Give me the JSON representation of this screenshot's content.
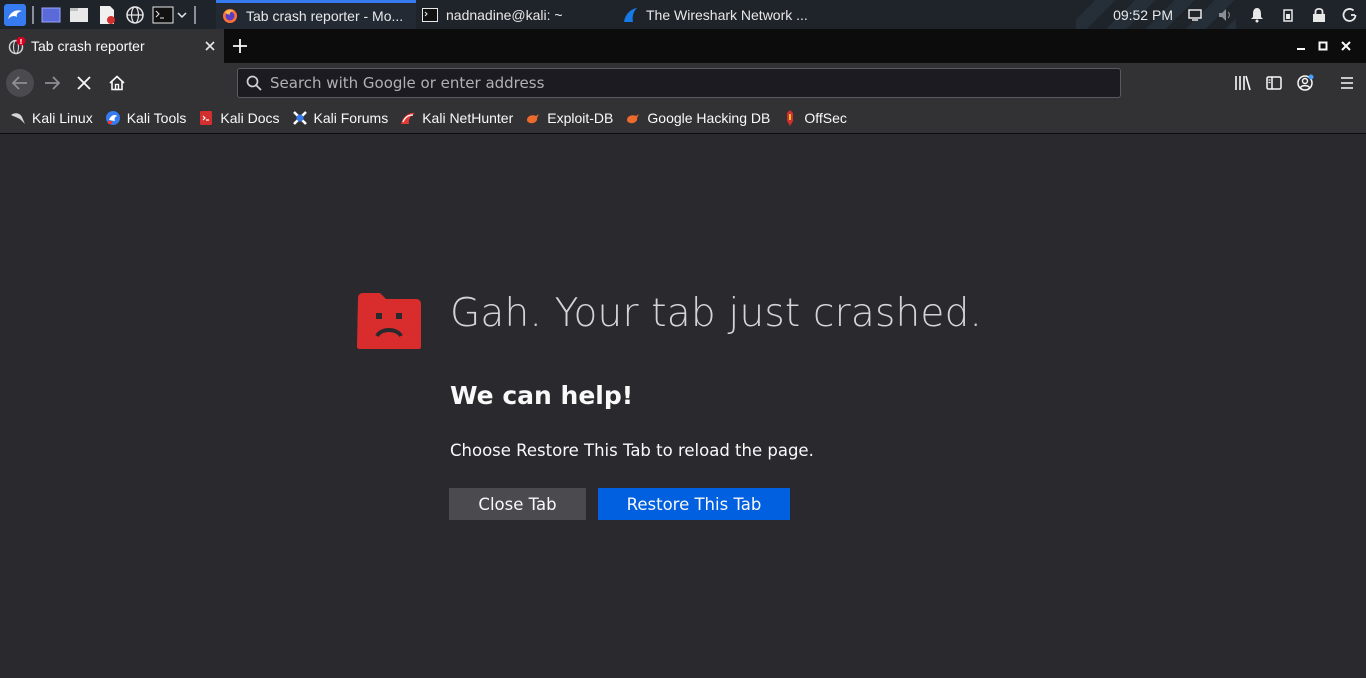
{
  "taskbar": {
    "tasks": [
      {
        "label": "Tab crash reporter - Mo...",
        "icon": "firefox-icon",
        "active": true
      },
      {
        "label": "nadnadine@kali: ~",
        "icon": "terminal-icon",
        "active": false
      },
      {
        "label": "The Wireshark Network ...",
        "icon": "wireshark-icon",
        "active": false
      }
    ],
    "clock": "09:52 PM"
  },
  "tab": {
    "title": "Tab crash reporter"
  },
  "urlbar": {
    "placeholder": "Search with Google or enter address"
  },
  "bookmarks": [
    {
      "label": "Kali Linux",
      "icon": "kali-dragon-icon"
    },
    {
      "label": "Kali Tools",
      "icon": "kali-tools-icon"
    },
    {
      "label": "Kali Docs",
      "icon": "kali-docs-icon"
    },
    {
      "label": "Kali Forums",
      "icon": "kali-forums-icon"
    },
    {
      "label": "Kali NetHunter",
      "icon": "nethunter-icon"
    },
    {
      "label": "Exploit-DB",
      "icon": "exploit-db-icon"
    },
    {
      "label": "Google Hacking DB",
      "icon": "ghdb-icon"
    },
    {
      "label": "OffSec",
      "icon": "offsec-icon"
    }
  ],
  "crash": {
    "headline": "Gah. Your tab just crashed.",
    "subhead": "We can help!",
    "description": "Choose Restore This Tab to reload the page.",
    "close_button": "Close Tab",
    "restore_button": "Restore This Tab"
  },
  "colors": {
    "accent": "#0060df",
    "crash_icon": "#d92d2d",
    "taskbar_active": "#367bf0"
  }
}
